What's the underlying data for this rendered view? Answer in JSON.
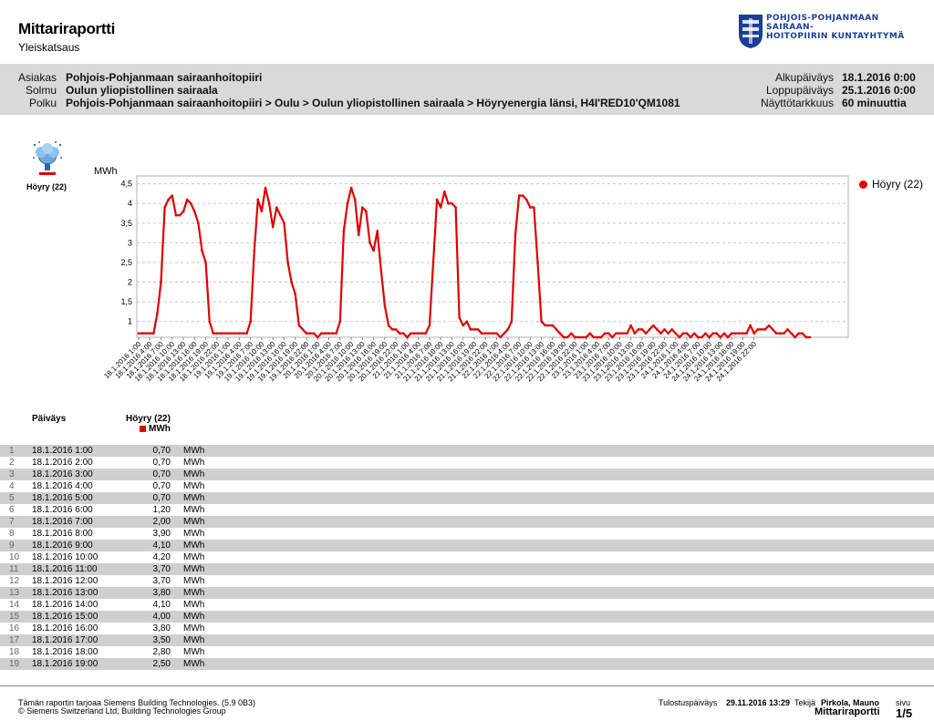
{
  "header": {
    "title": "Mittariraportti",
    "subtitle": "Yleiskatsaus",
    "logo_text_1": "POHJOIS-POHJANMAAN SAIRAAN-",
    "logo_text_2": "HOITOPIIRIN KUNTAYHTYMÄ"
  },
  "info": {
    "asiakas_label": "Asiakas",
    "asiakas": "Pohjois-Pohjanmaan sairaanhoitopiiri",
    "solmu_label": "Solmu",
    "solmu": "Oulun yliopistollinen sairaala",
    "polku_label": "Polku",
    "polku": "Pohjois-Pohjanmaan sairaanhoitopiiri > Oulu > Oulun yliopistollinen sairaala > Höyryenergia länsi, H4I'RED10'QM1081",
    "alku_label": "Alkupäiväys",
    "alku": "18.1.2016 0:00",
    "loppu_label": "Loppupäiväys",
    "loppu": "25.1.2016 0:00",
    "naytto_label": "Näyttötarkkuus",
    "naytto": "60 minuuttia"
  },
  "icon_caption": "Höyry (22)",
  "colors": {
    "series": "#e00000",
    "band": "#d9d9d9",
    "logo": "#1c3f95"
  },
  "chart_data": {
    "type": "line",
    "ylabel": "MWh",
    "ylim": [
      0.6,
      4.5
    ],
    "yticks": [
      1,
      1.5,
      2,
      2.5,
      3,
      3.5,
      4,
      4.5
    ],
    "ytick_labels": [
      "1",
      "1,5",
      "2",
      "2,5",
      "3",
      "3,5",
      "4",
      "4,5"
    ],
    "x_start": "18.1.2016 1:00",
    "x_step_hours": 1,
    "xtick_labels": [
      "18.1.2016 1:00",
      "18.1.2016 4:00",
      "18.1.2016 7:00",
      "18.1.2016 10:00",
      "18.1.2016 13:00",
      "18.1.2016 16:00",
      "18.1.2016 19:00",
      "18.1.2016 22:00",
      "19.1.2016 1:00",
      "19.1.2016 4:00",
      "19.1.2016 7:00",
      "19.1.2016 10:00",
      "19.1.2016 13:00",
      "19.1.2016 16:00",
      "19.1.2016 19:00",
      "19.1.2016 22:00",
      "20.1.2016 1:00",
      "20.1.2016 4:00",
      "20.1.2016 7:00",
      "20.1.2016 10:00",
      "20.1.2016 13:00",
      "20.1.2016 16:00",
      "20.1.2016 19:00",
      "20.1.2016 22:00",
      "21.1.2016 1:00",
      "21.1.2016 4:00",
      "21.1.2016 7:00",
      "21.1.2016 10:00",
      "21.1.2016 13:00",
      "21.1.2016 16:00",
      "21.1.2016 19:00",
      "21.1.2016 22:00",
      "22.1.2016 1:00",
      "22.1.2016 4:00",
      "22.1.2016 7:00",
      "22.1.2016 10:00",
      "22.1.2016 13:00",
      "22.1.2016 16:00",
      "22.1.2016 19:00",
      "22.1.2016 22:00",
      "23.1.2016 1:00",
      "23.1.2016 4:00",
      "23.1.2016 7:00",
      "23.1.2016 10:00",
      "23.1.2016 13:00",
      "23.1.2016 16:00",
      "23.1.2016 19:00",
      "23.1.2016 22:00",
      "24.1.2016 1:00",
      "24.1.2016 4:00",
      "24.1.2016 7:00",
      "24.1.2016 10:00",
      "24.1.2016 13:00",
      "24.1.2016 16:00",
      "24.1.2016 19:00",
      "24.1.2016 22:00"
    ],
    "grid": true,
    "legend": "top-right",
    "series": [
      {
        "name": "Höyry (22)",
        "values": [
          0.7,
          0.7,
          0.7,
          0.7,
          0.7,
          1.2,
          2.0,
          3.9,
          4.1,
          4.2,
          3.7,
          3.7,
          3.8,
          4.1,
          4.0,
          3.8,
          3.5,
          2.8,
          2.5,
          1.0,
          0.7,
          0.7,
          0.7,
          0.7,
          0.7,
          0.7,
          0.7,
          0.7,
          0.7,
          0.7,
          1.0,
          2.8,
          4.1,
          3.8,
          4.4,
          4.0,
          3.4,
          3.9,
          3.7,
          3.5,
          2.5,
          2.0,
          1.7,
          0.9,
          0.8,
          0.7,
          0.7,
          0.7,
          0.6,
          0.7,
          0.7,
          0.7,
          0.7,
          0.7,
          1.0,
          3.3,
          4.0,
          4.4,
          4.1,
          3.2,
          3.9,
          3.8,
          3.0,
          2.8,
          3.3,
          2.3,
          1.4,
          0.9,
          0.8,
          0.8,
          0.7,
          0.7,
          0.6,
          0.7,
          0.7,
          0.7,
          0.7,
          0.7,
          0.9,
          2.5,
          4.1,
          3.9,
          4.3,
          4.0,
          4.0,
          3.9,
          1.1,
          0.9,
          1.0,
          0.8,
          0.8,
          0.8,
          0.7,
          0.7,
          0.7,
          0.7,
          0.7,
          0.6,
          0.7,
          0.8,
          1.0,
          3.2,
          4.2,
          4.2,
          4.1,
          3.9,
          3.9,
          2.5,
          1.0,
          0.9,
          0.9,
          0.9,
          0.8,
          0.7,
          0.6,
          0.6,
          0.7,
          0.6,
          0.6,
          0.6,
          0.6,
          0.7,
          0.6,
          0.6,
          0.6,
          0.7,
          0.7,
          0.6,
          0.7,
          0.7,
          0.7,
          0.7,
          0.9,
          0.7,
          0.8,
          0.8,
          0.7,
          0.8,
          0.9,
          0.8,
          0.7,
          0.8,
          0.7,
          0.8,
          0.7,
          0.6,
          0.7,
          0.7,
          0.6,
          0.7,
          0.6,
          0.6,
          0.7,
          0.6,
          0.7,
          0.7,
          0.6,
          0.7,
          0.6,
          0.7,
          0.7,
          0.7,
          0.7,
          0.7,
          0.9,
          0.7,
          0.8,
          0.8,
          0.8,
          0.9,
          0.8,
          0.7,
          0.7,
          0.7,
          0.8,
          0.7,
          0.6,
          0.7,
          0.7,
          0.6,
          0.6
        ]
      }
    ]
  },
  "table": {
    "header_date": "Päiväys",
    "header_series": "Höyry (22)",
    "header_unit": "MWh",
    "rows": [
      {
        "n": "1",
        "date": "18.1.2016 1:00",
        "value": "0,70",
        "unit": "MWh"
      },
      {
        "n": "2",
        "date": "18.1.2016 2:00",
        "value": "0,70",
        "unit": "MWh"
      },
      {
        "n": "3",
        "date": "18.1.2016 3:00",
        "value": "0,70",
        "unit": "MWh"
      },
      {
        "n": "4",
        "date": "18.1.2016 4:00",
        "value": "0,70",
        "unit": "MWh"
      },
      {
        "n": "5",
        "date": "18.1.2016 5:00",
        "value": "0,70",
        "unit": "MWh"
      },
      {
        "n": "6",
        "date": "18.1.2016 6:00",
        "value": "1,20",
        "unit": "MWh"
      },
      {
        "n": "7",
        "date": "18.1.2016 7:00",
        "value": "2,00",
        "unit": "MWh"
      },
      {
        "n": "8",
        "date": "18.1.2016 8:00",
        "value": "3,90",
        "unit": "MWh"
      },
      {
        "n": "9",
        "date": "18.1.2016 9:00",
        "value": "4,10",
        "unit": "MWh"
      },
      {
        "n": "10",
        "date": "18.1.2016 10:00",
        "value": "4,20",
        "unit": "MWh"
      },
      {
        "n": "11",
        "date": "18.1.2016 11:00",
        "value": "3,70",
        "unit": "MWh"
      },
      {
        "n": "12",
        "date": "18.1.2016 12:00",
        "value": "3,70",
        "unit": "MWh"
      },
      {
        "n": "13",
        "date": "18.1.2016 13:00",
        "value": "3,80",
        "unit": "MWh"
      },
      {
        "n": "14",
        "date": "18.1.2016 14:00",
        "value": "4,10",
        "unit": "MWh"
      },
      {
        "n": "15",
        "date": "18.1.2016 15:00",
        "value": "4,00",
        "unit": "MWh"
      },
      {
        "n": "16",
        "date": "18.1.2016 16:00",
        "value": "3,80",
        "unit": "MWh"
      },
      {
        "n": "17",
        "date": "18.1.2016 17:00",
        "value": "3,50",
        "unit": "MWh"
      },
      {
        "n": "18",
        "date": "18.1.2016 18:00",
        "value": "2,80",
        "unit": "MWh"
      },
      {
        "n": "19",
        "date": "18.1.2016 19:00",
        "value": "2,50",
        "unit": "MWh"
      }
    ]
  },
  "footer": {
    "line1": "Tämän raportin tarjoaa Siemens Building Technologies. (5.9 0B3)",
    "line2": "© Siemens Switzerland Ltd, Building Technologies Group",
    "print_label": "Tulostuspäiväys",
    "print_date": "29.11.2016 13:29",
    "maker_label": "Tekijä",
    "maker": "Pirkola, Mauno",
    "report_name": "Mittariraportti",
    "page_label": "sivu",
    "page": "1/5"
  }
}
